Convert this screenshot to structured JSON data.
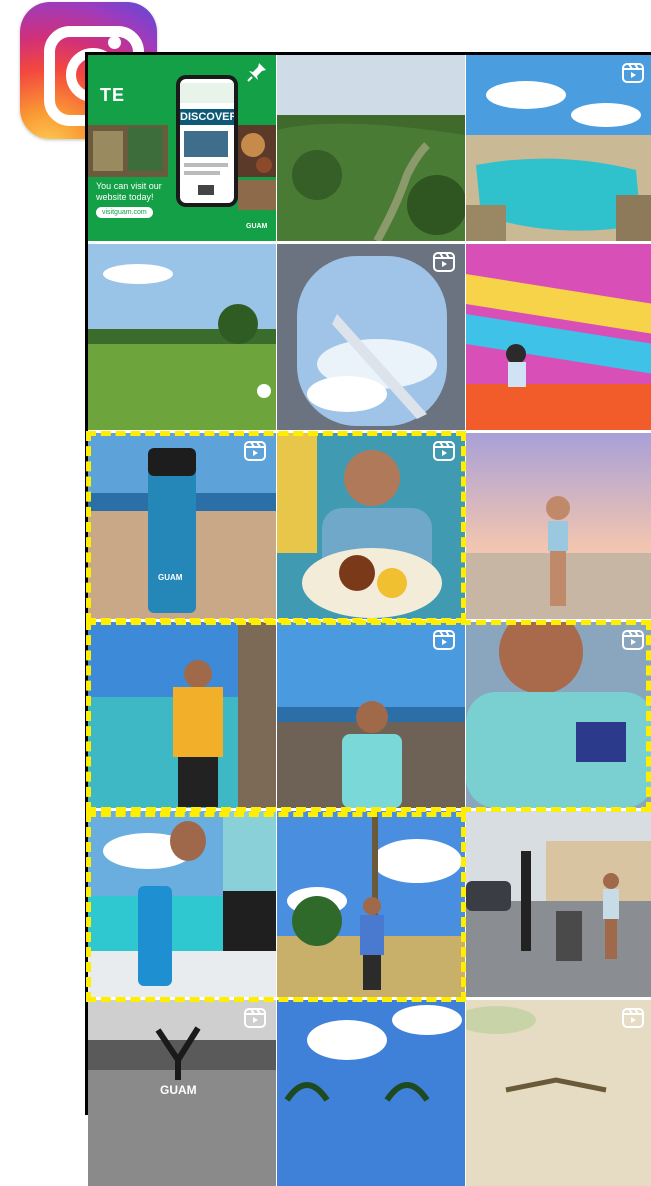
{
  "app": {
    "logo_icon": "instagram-icon",
    "highlight_color": "#ffee00"
  },
  "promo": {
    "heading": "TE",
    "phone_screen_title": "DISCOVER",
    "caption_lines": [
      "You can visit our",
      "website today!"
    ],
    "url_pill": "visitguam.com",
    "brand": "GUAM"
  },
  "posts": [
    {
      "name": "post-promo",
      "badge": "pin-icon"
    },
    {
      "name": "post-jungle-valley",
      "badge": ""
    },
    {
      "name": "post-cliff-pool",
      "badge": "reels-icon"
    },
    {
      "name": "post-golf-course",
      "badge": ""
    },
    {
      "name": "post-airplane-window",
      "badge": "reels-icon"
    },
    {
      "name": "post-colorful-slide",
      "badge": ""
    },
    {
      "name": "post-blue-bottle-beach",
      "badge": "reels-icon",
      "label": "GUAM"
    },
    {
      "name": "post-man-with-plate",
      "badge": "reels-icon"
    },
    {
      "name": "post-woman-sunset-beach",
      "badge": ""
    },
    {
      "name": "post-man-yellow-shirt",
      "badge": ""
    },
    {
      "name": "post-man-tiedye-rocks",
      "badge": "reels-icon"
    },
    {
      "name": "post-man-tiedye-closeup",
      "badge": "reels-icon"
    },
    {
      "name": "post-hand-bottle-beach",
      "badge": ""
    },
    {
      "name": "post-man-palm-beach",
      "badge": ""
    },
    {
      "name": "post-street-stroller",
      "badge": ""
    },
    {
      "name": "post-bw-handstand",
      "badge": "reels-icon",
      "label": "GUAM"
    },
    {
      "name": "post-palms-sky",
      "badge": ""
    },
    {
      "name": "post-sand-wall",
      "badge": "reels-icon"
    }
  ]
}
